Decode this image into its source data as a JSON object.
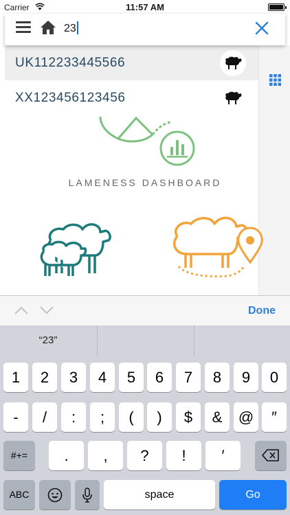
{
  "status_bar": {
    "carrier": "Carrier",
    "time": "11:57 AM"
  },
  "search": {
    "value": "23"
  },
  "results": [
    {
      "tag": "UK112233445566",
      "icon": "sheep-icon"
    },
    {
      "tag": "XX123456123456",
      "icon": "sheep-icon"
    }
  ],
  "dashboard": {
    "lameness_label": "LAMENESS DASHBOARD"
  },
  "accessory": {
    "done_label": "Done"
  },
  "keyboard": {
    "suggestion": "“23”",
    "row1": [
      "1",
      "2",
      "3",
      "4",
      "5",
      "6",
      "7",
      "8",
      "9",
      "0"
    ],
    "row2": [
      "-",
      "/",
      ":",
      ";",
      "(",
      ")",
      "$",
      "&",
      "@",
      "″"
    ],
    "row3": [
      ".",
      ",",
      "?",
      "!",
      "′"
    ],
    "symbols_label": "#+=",
    "abc_label": "ABC",
    "space_label": "space",
    "go_label": "Go"
  },
  "colors": {
    "accent_blue": "#2f80d8",
    "teal": "#1f7b7b",
    "orange": "#f2a33a",
    "green": "#7cc27e"
  }
}
